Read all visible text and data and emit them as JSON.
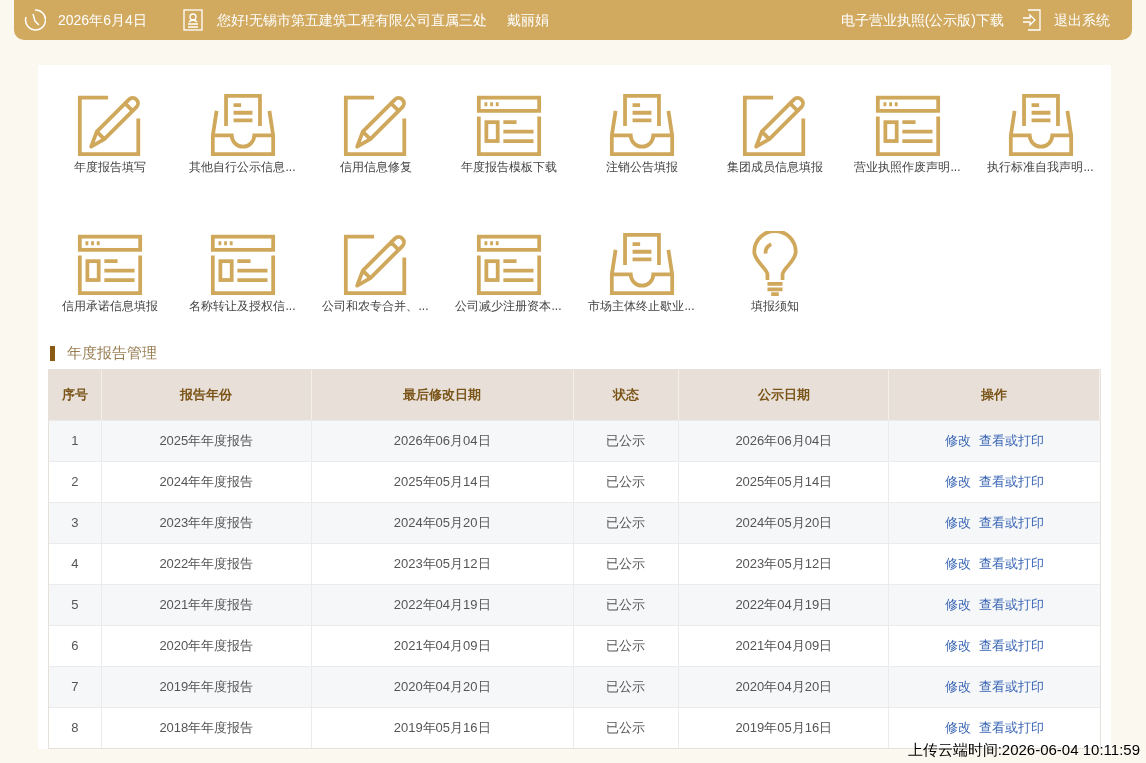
{
  "top_bar": {
    "date": "2026年6月4日",
    "greeting": "您好!无锡市第五建筑工程有限公司直属三处",
    "user": "戴丽娟",
    "license_link": "电子营业执照(公示版)下载",
    "logout": "退出系统"
  },
  "tiles": [
    {
      "kind": "pencil",
      "label": "年度报告填写"
    },
    {
      "kind": "inbox",
      "label": "其他自行公示信息..."
    },
    {
      "kind": "pencil",
      "label": "信用信息修复"
    },
    {
      "kind": "template",
      "label": "年度报告模板下载"
    },
    {
      "kind": "inbox",
      "label": "注销公告填报"
    },
    {
      "kind": "pencil",
      "label": "集团成员信息填报"
    },
    {
      "kind": "template",
      "label": "营业执照作废声明..."
    },
    {
      "kind": "inbox",
      "label": "执行标准自我声明..."
    },
    {
      "kind": "template",
      "label": "信用承诺信息填报"
    },
    {
      "kind": "template",
      "label": "名称转让及授权信..."
    },
    {
      "kind": "pencil",
      "label": "公司和农专合并、..."
    },
    {
      "kind": "template",
      "label": "公司减少注册资本..."
    },
    {
      "kind": "inbox",
      "label": "市场主体终止歇业..."
    },
    {
      "kind": "bulb",
      "label": "填报须知"
    }
  ],
  "section_title": "年度报告管理",
  "table": {
    "columns": [
      "序号",
      "报告年份",
      "最后修改日期",
      "状态",
      "公示日期",
      "操作"
    ],
    "rows": [
      {
        "cells": [
          "1",
          "2025年年度报告",
          "2026年06月04日",
          "已公示",
          "2026年06月04日"
        ],
        "actions": [
          "修改",
          "查看或打印"
        ]
      },
      {
        "cells": [
          "2",
          "2024年年度报告",
          "2025年05月14日",
          "已公示",
          "2025年05月14日"
        ],
        "actions": [
          "修改",
          "查看或打印"
        ]
      },
      {
        "cells": [
          "3",
          "2023年年度报告",
          "2024年05月20日",
          "已公示",
          "2024年05月20日"
        ],
        "actions": [
          "修改",
          "查看或打印"
        ]
      },
      {
        "cells": [
          "4",
          "2022年年度报告",
          "2023年05月12日",
          "已公示",
          "2023年05月12日"
        ],
        "actions": [
          "修改",
          "查看或打印"
        ]
      },
      {
        "cells": [
          "5",
          "2021年年度报告",
          "2022年04月19日",
          "已公示",
          "2022年04月19日"
        ],
        "actions": [
          "修改",
          "查看或打印"
        ]
      },
      {
        "cells": [
          "6",
          "2020年年度报告",
          "2021年04月09日",
          "已公示",
          "2021年04月09日"
        ],
        "actions": [
          "修改",
          "查看或打印"
        ]
      },
      {
        "cells": [
          "7",
          "2019年年度报告",
          "2020年04月20日",
          "已公示",
          "2020年04月20日"
        ],
        "actions": [
          "修改",
          "查看或打印"
        ]
      },
      {
        "cells": [
          "8",
          "2018年年度报告",
          "2019年05月16日",
          "已公示",
          "2019年05月16日"
        ],
        "actions": [
          "修改",
          "查看或打印"
        ]
      }
    ]
  },
  "upload_stamp": "上传云端时间:2026-06-04 10:11:59"
}
